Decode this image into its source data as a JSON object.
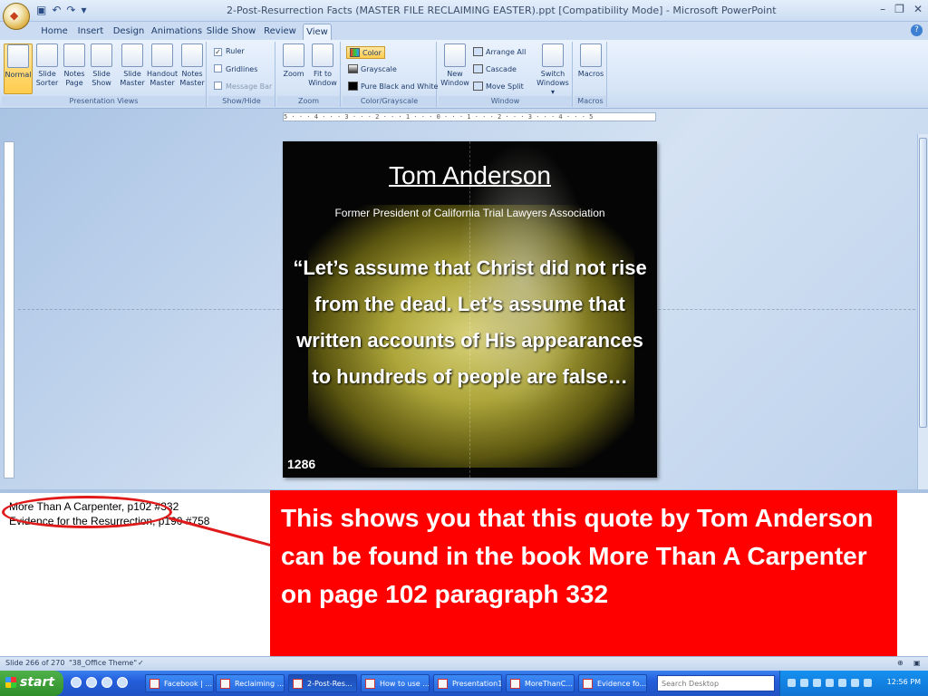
{
  "window": {
    "title": "2-Post-Resurrection Facts (MASTER FILE RECLAIMING EASTER).ppt [Compatibility Mode] - Microsoft PowerPoint",
    "minimize": "–",
    "restore": "❐",
    "close": "✕"
  },
  "tabs": [
    "Home",
    "Insert",
    "Design",
    "Animations",
    "Slide Show",
    "Review",
    "View"
  ],
  "active_tab": "View",
  "ribbon": {
    "presentation_views": {
      "label": "Presentation Views",
      "normal": "Normal",
      "slide_sorter": [
        "Slide",
        "Sorter"
      ],
      "notes_page": [
        "Notes",
        "Page"
      ],
      "slide_show": [
        "Slide",
        "Show"
      ],
      "slide_master": [
        "Slide",
        "Master"
      ],
      "handout_master": [
        "Handout",
        "Master"
      ],
      "notes_master": [
        "Notes",
        "Master"
      ]
    },
    "show_hide": {
      "label": "Show/Hide",
      "ruler": "Ruler",
      "gridlines": "Gridlines",
      "message_bar": "Message Bar"
    },
    "zoom": {
      "label": "Zoom",
      "zoom": "Zoom",
      "fit": [
        "Fit to",
        "Window"
      ]
    },
    "color": {
      "label": "Color/Grayscale",
      "color": "Color",
      "grayscale": "Grayscale",
      "pure": "Pure Black and White"
    },
    "window": {
      "label": "Window",
      "new_window": [
        "New",
        "Window"
      ],
      "arrange_all": "Arrange All",
      "cascade": "Cascade",
      "move_split": "Move Split",
      "switch": [
        "Switch",
        "Windows ▾"
      ]
    },
    "macros": {
      "label": "Macros",
      "macros": "Macros"
    }
  },
  "ruler_text": "5 · · · 4 · · · 3 · · · 2 · · · 1 · · · 0 · · · 1 · · · 2 · · · 3 · · · 4 · · · 5",
  "slide": {
    "title": "Tom Anderson",
    "subtitle": "Former President of California Trial Lawyers Association",
    "quote": "“Let’s assume that Christ did not rise from the dead. Let’s assume that written accounts of His appearances to hundreds of people are false…",
    "number": "1286"
  },
  "notes": {
    "line1": "More Than A Carpenter, p102 #332",
    "line2": "Evidence for the Resurrection, p190 #758"
  },
  "callout": "This shows you that this quote by Tom Anderson can be found in the book More Than A Carpenter on page 102 paragraph 332",
  "status": {
    "slide": "Slide 266 of 270",
    "theme": "\"38_Office Theme\""
  },
  "taskbar": {
    "start": "start",
    "tasks": [
      "Facebook | ...",
      "Reclaiming ...",
      "2-Post-Res...",
      "How to use ...",
      "Presentation1",
      "MoreThanC...",
      "Evidence fo..."
    ],
    "search_placeholder": "Search Desktop",
    "clock": "12:56 PM"
  },
  "colors": {
    "callout_red": "#ff0000",
    "ribbon_blue": "#d7e5f7",
    "taskbar_blue": "#245edb"
  }
}
